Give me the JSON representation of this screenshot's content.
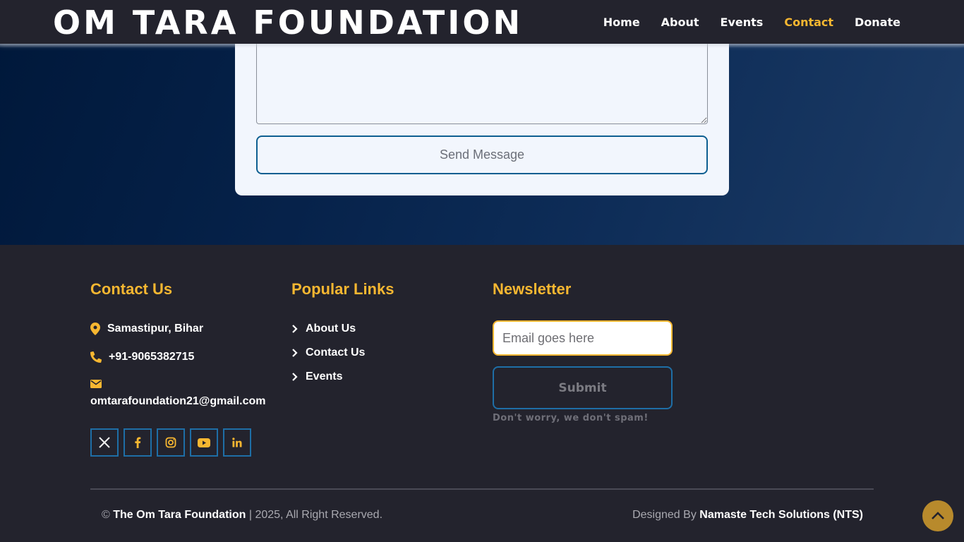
{
  "brand": {
    "title": "OM TARA FOUNDATION"
  },
  "nav": {
    "items": [
      {
        "label": "Home",
        "active": false
      },
      {
        "label": "About",
        "active": false
      },
      {
        "label": "Events",
        "active": false
      },
      {
        "label": "Contact",
        "active": true
      },
      {
        "label": "Donate",
        "active": false
      }
    ]
  },
  "contact_form": {
    "message_value": "",
    "send_label": "Send Message"
  },
  "footer": {
    "contact": {
      "title": "Contact Us",
      "address": "Samastipur, Bihar",
      "phone": "+91-9065382715",
      "email": "omtarafoundation21@gmail.com",
      "socials": [
        {
          "icon": "x-twitter-icon"
        },
        {
          "icon": "facebook-icon"
        },
        {
          "icon": "instagram-icon"
        },
        {
          "icon": "youtube-icon"
        },
        {
          "icon": "linkedin-icon"
        }
      ]
    },
    "links": {
      "title": "Popular Links",
      "items": [
        "About Us",
        "Contact Us",
        "Events"
      ]
    },
    "newsletter": {
      "title": "Newsletter",
      "email_placeholder": "Email goes here",
      "submit_label": "Submit",
      "note": "Don't worry, we don't spam!"
    },
    "copyright": {
      "symbol": "©",
      "org": "The Om Tara Foundation",
      "rest": "| 2025, All Right Reserved."
    },
    "designed": {
      "prefix": "Designed By",
      "company": "Namaste Tech Solutions (NTS)"
    }
  },
  "colors": {
    "accent": "#f7b731",
    "border_blue": "#1e6ea6",
    "background": "#23232d"
  }
}
